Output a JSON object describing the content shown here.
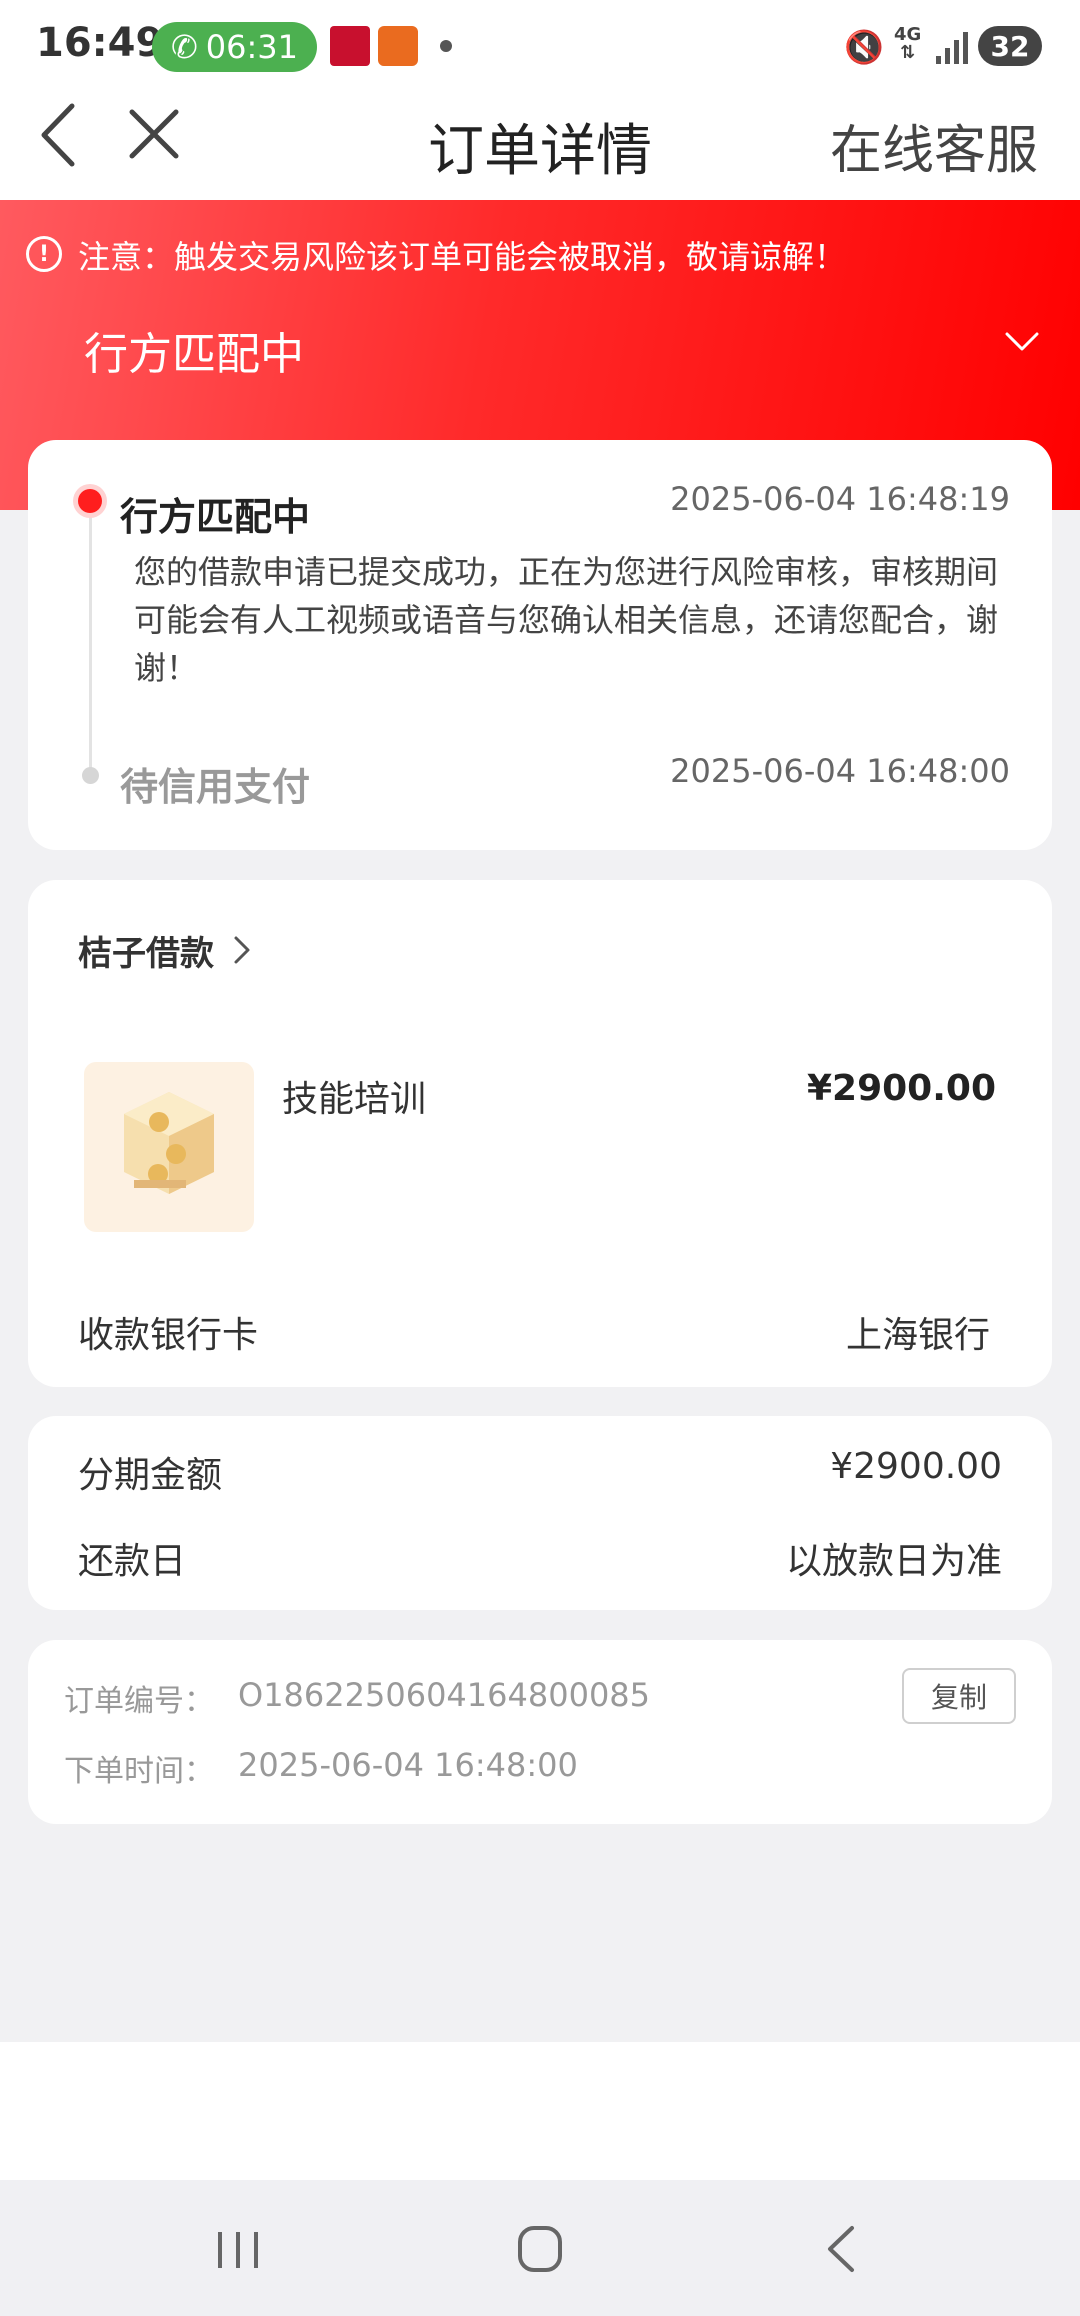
{
  "status_bar": {
    "time": "16:49",
    "call_duration": "06:31",
    "battery": "32",
    "network": "4G"
  },
  "header": {
    "title": "订单详情",
    "service_label": "在线客服"
  },
  "banner": {
    "warning": "注意：触发交易风险该订单可能会被取消，敬请谅解！",
    "status": "行方匹配中"
  },
  "timeline": [
    {
      "title": "行方匹配中",
      "time": "2025-06-04 16:48:19",
      "description": "您的借款申请已提交成功，正在为您进行风险审核，审核期间可能会有人工视频或语音与您确认相关信息，还请您配合，谢谢！"
    },
    {
      "title": "待信用支付",
      "time": "2025-06-04 16:48:00"
    }
  ],
  "product": {
    "merchant": "桔子借款",
    "name": "技能培训",
    "price": "¥2900.00",
    "bank_label": "收款银行卡",
    "bank_value": "上海银行"
  },
  "installment": {
    "amount_label": "分期金额",
    "amount_value": "¥2900.00",
    "due_label": "还款日",
    "due_value": "以放款日为准"
  },
  "order_info": {
    "number_label": "订单编号：",
    "number_value": "O1862250604164800085",
    "time_label": "下单时间：",
    "time_value": "2025-06-04 16:48:00",
    "copy_label": "复制"
  },
  "colors": {
    "accent": "#ff1e1e",
    "banner_start": "#ff5a5f",
    "banner_end": "#ff0000",
    "call_green": "#4cb050"
  }
}
